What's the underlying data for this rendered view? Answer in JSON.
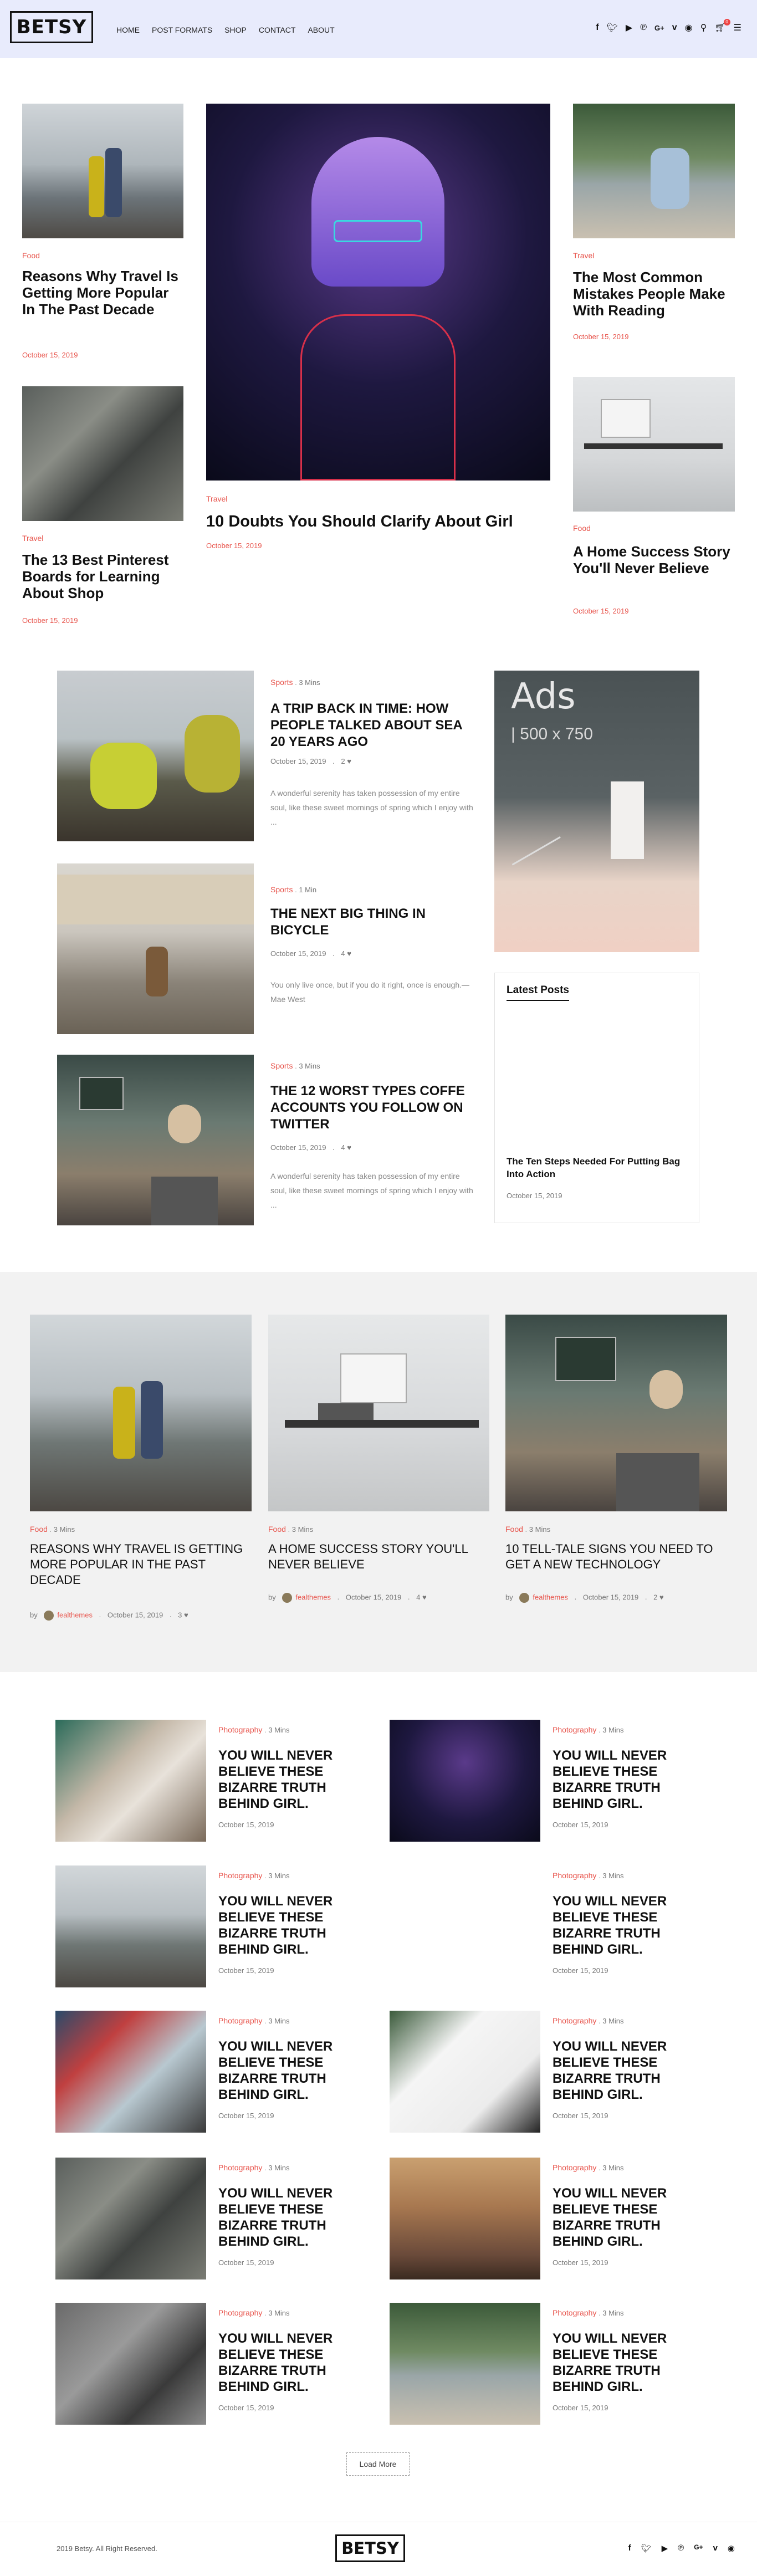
{
  "header": {
    "logo": "BETSY",
    "nav": [
      "HOME",
      "POST FORMATS",
      "SHOP",
      "CONTACT",
      "ABOUT"
    ],
    "icons": [
      "facebook-icon",
      "twitter-icon",
      "youtube-icon",
      "pinterest-icon",
      "google-plus-icon",
      "vimeo-icon",
      "spotify-icon",
      "search-icon",
      "cart-icon",
      "menu-icon"
    ],
    "cart_count": "0"
  },
  "hero": {
    "left_top": {
      "category": "Food",
      "title": "Reasons Why Travel Is Getting More Popular In The Past Decade",
      "date": "October 15, 2019"
    },
    "left_bottom": {
      "category": "Travel",
      "title": "The 13 Best Pinterest Boards for Learning About Shop",
      "date": "October 15, 2019"
    },
    "center": {
      "category": "Travel",
      "title": "10 Doubts You Should Clarify About Girl",
      "date": "October 15, 2019"
    },
    "right_top": {
      "category": "Travel",
      "title": "The Most Common Mistakes People Make With Reading",
      "date": "October 15, 2019"
    },
    "right_bottom": {
      "category": "Food",
      "title": "A Home Success Story You'll Never Believe",
      "date": "October 15, 2019"
    }
  },
  "list": [
    {
      "category": "Sports",
      "read": "3 Mins",
      "title": "A TRIP BACK IN TIME: HOW PEOPLE TALKED ABOUT SEA 20 YEARS AGO",
      "date": "October 15, 2019",
      "comments": "2",
      "excerpt": "A wonderful serenity has taken possession of my entire soul, like these sweet mornings of spring which I enjoy with ..."
    },
    {
      "category": "Sports",
      "read": "1 Min",
      "title": "THE NEXT BIG THING IN BICYCLE",
      "date": "October 15, 2019",
      "comments": "4",
      "excerpt": "You only live once, but if you do it right, once is enough.— Mae West"
    },
    {
      "category": "Sports",
      "read": "3 Mins",
      "title": "THE 12 WORST TYPES COFFE ACCOUNTS YOU FOLLOW ON TWITTER",
      "date": "October 15, 2019",
      "comments": "4",
      "excerpt": "A wonderful serenity has taken possession of my entire soul, like these sweet mornings of spring which I enjoy with ..."
    }
  ],
  "sidebar": {
    "ads_title": "Ads",
    "ads_size": "| 500 x 750",
    "latest_heading": "Latest Posts",
    "latest_title": "The Ten Steps Needed For Putting Bag Into Action",
    "latest_date": "October 15, 2019"
  },
  "band": [
    {
      "category": "Food",
      "read": "3 Mins",
      "title": "REASONS WHY TRAVEL IS GETTING MORE POPULAR IN THE PAST DECADE",
      "author": "fealthemes",
      "date": "October 15, 2019",
      "comments": "3"
    },
    {
      "category": "Food",
      "read": "3 Mins",
      "title": "A HOME SUCCESS STORY YOU'LL NEVER BELIEVE",
      "author": "fealthemes",
      "date": "October 15, 2019",
      "comments": "4"
    },
    {
      "category": "Food",
      "read": "3 Mins",
      "title": "10 TELL-TALE SIGNS YOU NEED TO GET A NEW TECHNOLOGY",
      "author": "fealthemes",
      "date": "October 15, 2019",
      "comments": "2"
    }
  ],
  "band_by": "by",
  "grid": {
    "category": "Photography",
    "read": "3 Mins",
    "title": "YOU WILL NEVER BELIEVE THESE BIZARRE TRUTH BEHIND GIRL.",
    "date": "October 15, 2019"
  },
  "load_more": "Load More",
  "footer": {
    "copyright": "2019 Betsy. All Right Reserved.",
    "logo": "BETSY"
  }
}
